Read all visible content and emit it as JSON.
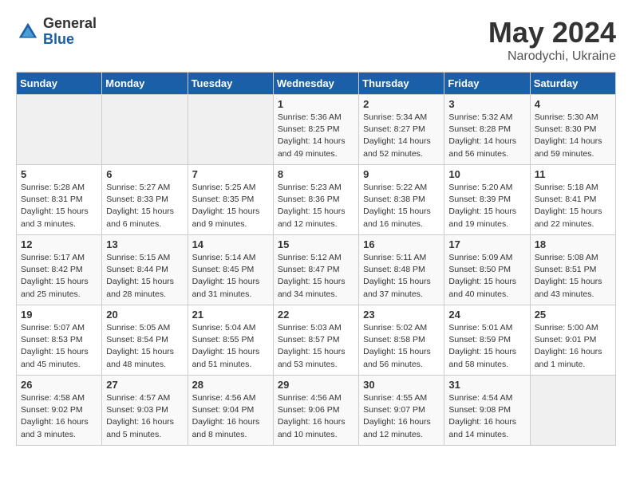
{
  "header": {
    "logo_general": "General",
    "logo_blue": "Blue",
    "month": "May 2024",
    "location": "Narodychi, Ukraine"
  },
  "weekdays": [
    "Sunday",
    "Monday",
    "Tuesday",
    "Wednesday",
    "Thursday",
    "Friday",
    "Saturday"
  ],
  "weeks": [
    [
      {
        "day": "",
        "info": ""
      },
      {
        "day": "",
        "info": ""
      },
      {
        "day": "",
        "info": ""
      },
      {
        "day": "1",
        "info": "Sunrise: 5:36 AM\nSunset: 8:25 PM\nDaylight: 14 hours\nand 49 minutes."
      },
      {
        "day": "2",
        "info": "Sunrise: 5:34 AM\nSunset: 8:27 PM\nDaylight: 14 hours\nand 52 minutes."
      },
      {
        "day": "3",
        "info": "Sunrise: 5:32 AM\nSunset: 8:28 PM\nDaylight: 14 hours\nand 56 minutes."
      },
      {
        "day": "4",
        "info": "Sunrise: 5:30 AM\nSunset: 8:30 PM\nDaylight: 14 hours\nand 59 minutes."
      }
    ],
    [
      {
        "day": "5",
        "info": "Sunrise: 5:28 AM\nSunset: 8:31 PM\nDaylight: 15 hours\nand 3 minutes."
      },
      {
        "day": "6",
        "info": "Sunrise: 5:27 AM\nSunset: 8:33 PM\nDaylight: 15 hours\nand 6 minutes."
      },
      {
        "day": "7",
        "info": "Sunrise: 5:25 AM\nSunset: 8:35 PM\nDaylight: 15 hours\nand 9 minutes."
      },
      {
        "day": "8",
        "info": "Sunrise: 5:23 AM\nSunset: 8:36 PM\nDaylight: 15 hours\nand 12 minutes."
      },
      {
        "day": "9",
        "info": "Sunrise: 5:22 AM\nSunset: 8:38 PM\nDaylight: 15 hours\nand 16 minutes."
      },
      {
        "day": "10",
        "info": "Sunrise: 5:20 AM\nSunset: 8:39 PM\nDaylight: 15 hours\nand 19 minutes."
      },
      {
        "day": "11",
        "info": "Sunrise: 5:18 AM\nSunset: 8:41 PM\nDaylight: 15 hours\nand 22 minutes."
      }
    ],
    [
      {
        "day": "12",
        "info": "Sunrise: 5:17 AM\nSunset: 8:42 PM\nDaylight: 15 hours\nand 25 minutes."
      },
      {
        "day": "13",
        "info": "Sunrise: 5:15 AM\nSunset: 8:44 PM\nDaylight: 15 hours\nand 28 minutes."
      },
      {
        "day": "14",
        "info": "Sunrise: 5:14 AM\nSunset: 8:45 PM\nDaylight: 15 hours\nand 31 minutes."
      },
      {
        "day": "15",
        "info": "Sunrise: 5:12 AM\nSunset: 8:47 PM\nDaylight: 15 hours\nand 34 minutes."
      },
      {
        "day": "16",
        "info": "Sunrise: 5:11 AM\nSunset: 8:48 PM\nDaylight: 15 hours\nand 37 minutes."
      },
      {
        "day": "17",
        "info": "Sunrise: 5:09 AM\nSunset: 8:50 PM\nDaylight: 15 hours\nand 40 minutes."
      },
      {
        "day": "18",
        "info": "Sunrise: 5:08 AM\nSunset: 8:51 PM\nDaylight: 15 hours\nand 43 minutes."
      }
    ],
    [
      {
        "day": "19",
        "info": "Sunrise: 5:07 AM\nSunset: 8:53 PM\nDaylight: 15 hours\nand 45 minutes."
      },
      {
        "day": "20",
        "info": "Sunrise: 5:05 AM\nSunset: 8:54 PM\nDaylight: 15 hours\nand 48 minutes."
      },
      {
        "day": "21",
        "info": "Sunrise: 5:04 AM\nSunset: 8:55 PM\nDaylight: 15 hours\nand 51 minutes."
      },
      {
        "day": "22",
        "info": "Sunrise: 5:03 AM\nSunset: 8:57 PM\nDaylight: 15 hours\nand 53 minutes."
      },
      {
        "day": "23",
        "info": "Sunrise: 5:02 AM\nSunset: 8:58 PM\nDaylight: 15 hours\nand 56 minutes."
      },
      {
        "day": "24",
        "info": "Sunrise: 5:01 AM\nSunset: 8:59 PM\nDaylight: 15 hours\nand 58 minutes."
      },
      {
        "day": "25",
        "info": "Sunrise: 5:00 AM\nSunset: 9:01 PM\nDaylight: 16 hours\nand 1 minute."
      }
    ],
    [
      {
        "day": "26",
        "info": "Sunrise: 4:58 AM\nSunset: 9:02 PM\nDaylight: 16 hours\nand 3 minutes."
      },
      {
        "day": "27",
        "info": "Sunrise: 4:57 AM\nSunset: 9:03 PM\nDaylight: 16 hours\nand 5 minutes."
      },
      {
        "day": "28",
        "info": "Sunrise: 4:56 AM\nSunset: 9:04 PM\nDaylight: 16 hours\nand 8 minutes."
      },
      {
        "day": "29",
        "info": "Sunrise: 4:56 AM\nSunset: 9:06 PM\nDaylight: 16 hours\nand 10 minutes."
      },
      {
        "day": "30",
        "info": "Sunrise: 4:55 AM\nSunset: 9:07 PM\nDaylight: 16 hours\nand 12 minutes."
      },
      {
        "day": "31",
        "info": "Sunrise: 4:54 AM\nSunset: 9:08 PM\nDaylight: 16 hours\nand 14 minutes."
      },
      {
        "day": "",
        "info": ""
      }
    ]
  ]
}
